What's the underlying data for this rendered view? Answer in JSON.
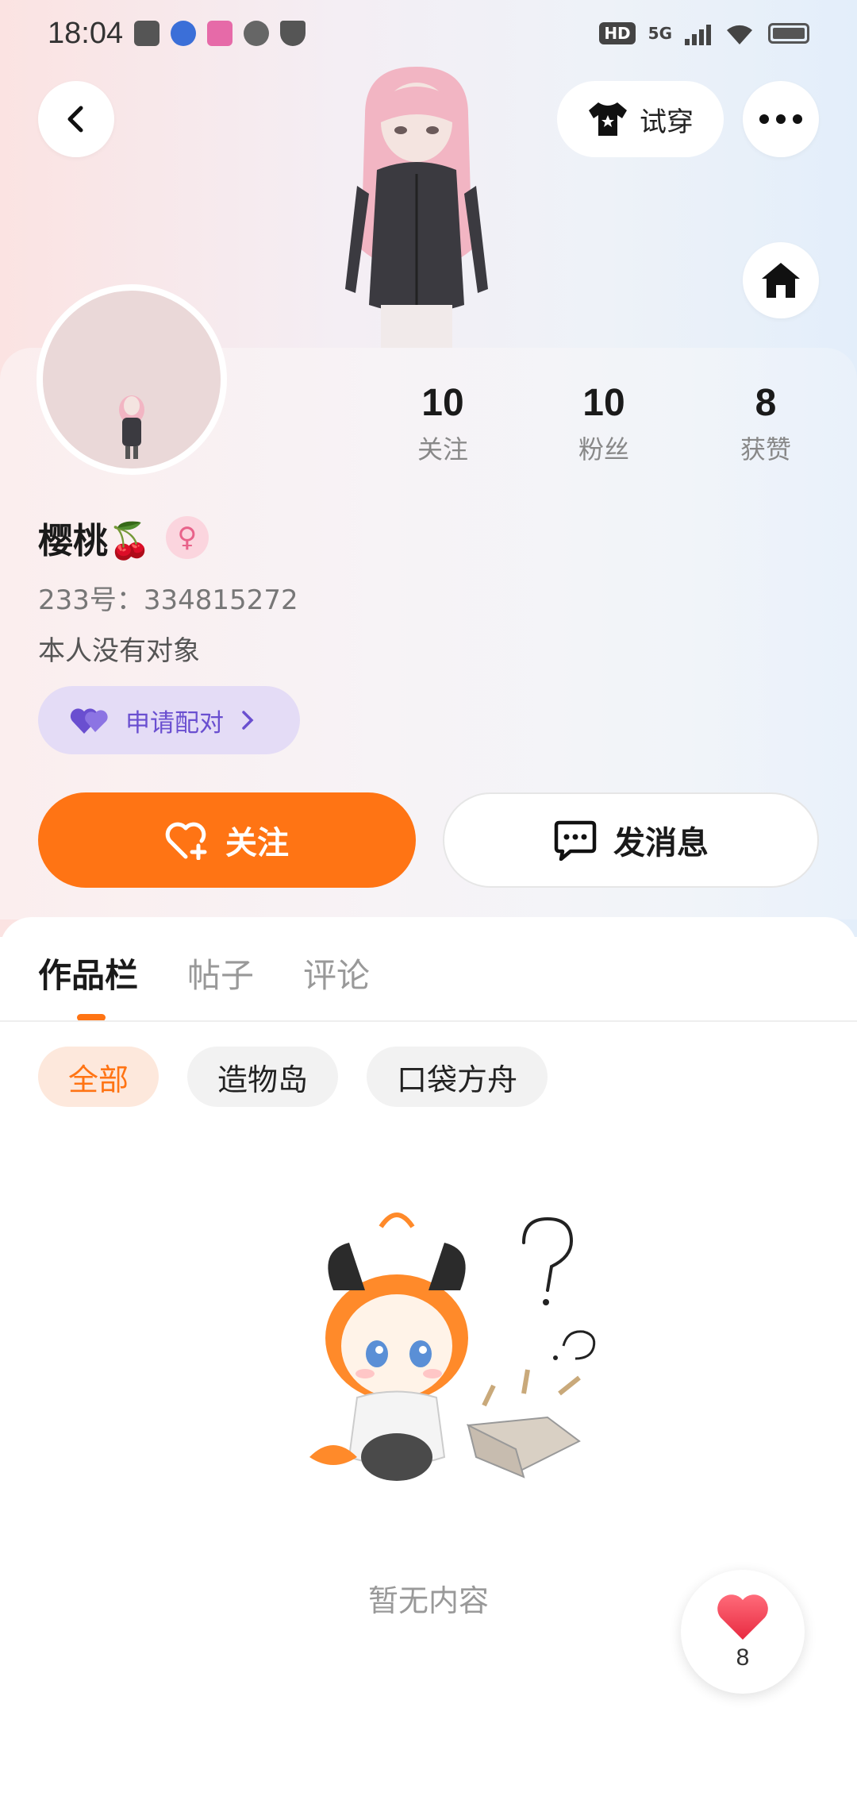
{
  "status_bar": {
    "time": "18:04",
    "network": "5G",
    "hd": "HD"
  },
  "header": {
    "tryon_label": "试穿",
    "icons": [
      "back-icon",
      "shirt-icon",
      "more-icon",
      "home-icon"
    ]
  },
  "profile": {
    "name": "樱桃🍒",
    "gender_symbol": "♀",
    "uid": "233号：334815272",
    "bio": "本人没有对象",
    "match_label": "申请配对",
    "stats": [
      {
        "value": "10",
        "label": "关注"
      },
      {
        "value": "10",
        "label": "粉丝"
      },
      {
        "value": "8",
        "label": "获赞"
      }
    ]
  },
  "actions": {
    "follow_label": "关注",
    "message_label": "发消息"
  },
  "tabs": [
    {
      "label": "作品栏",
      "active": true
    },
    {
      "label": "帖子",
      "active": false
    },
    {
      "label": "评论",
      "active": false
    }
  ],
  "filters": [
    {
      "label": "全部",
      "active": true
    },
    {
      "label": "造物岛",
      "active": false
    },
    {
      "label": "口袋方舟",
      "active": false
    }
  ],
  "empty_state": {
    "text": "暂无内容"
  },
  "like_fab": {
    "count": "8"
  },
  "colors": {
    "accent": "#ff7414",
    "match_purple": "#6a4fd0",
    "gender_pink": "#e8638a"
  }
}
